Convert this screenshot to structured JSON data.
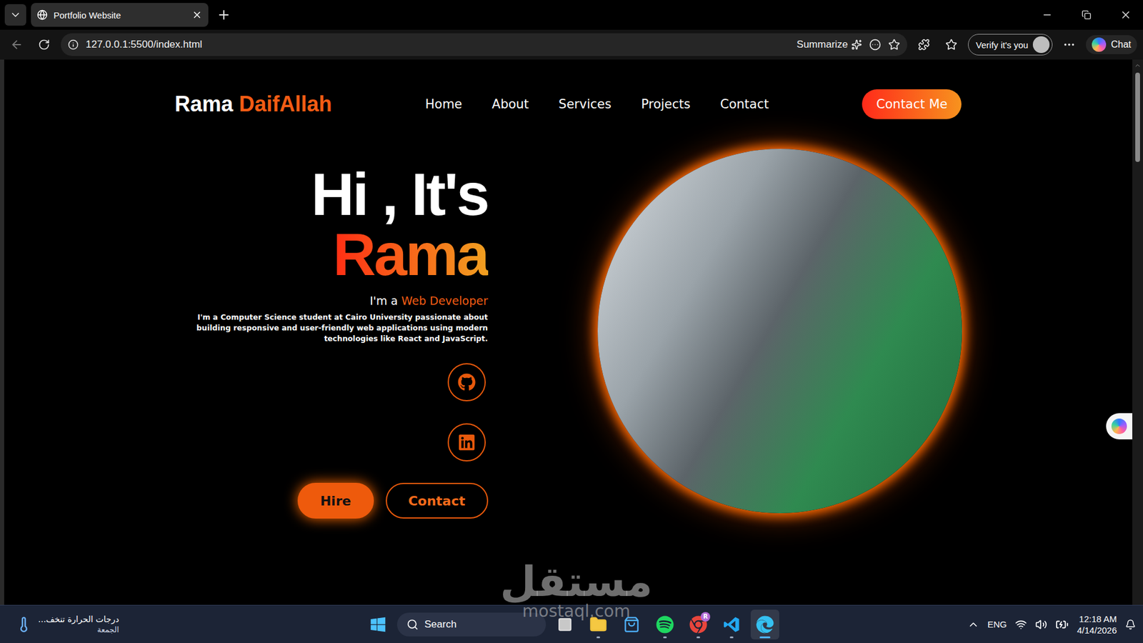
{
  "browser": {
    "tabs": [
      {
        "label": "Portfolio Website",
        "selected": true
      }
    ],
    "url": "127.0.0.1:5500/index.html",
    "summarize": "Summarize",
    "profile": "Verify it's you",
    "chat": "Chat"
  },
  "page": {
    "logo": {
      "first": "Rama",
      "last": "DaifAllah"
    },
    "nav": [
      {
        "label": "Home"
      },
      {
        "label": "About"
      },
      {
        "label": "Services"
      },
      {
        "label": "Projects"
      },
      {
        "label": "Contact"
      }
    ],
    "cta": "Contact Me",
    "hero": {
      "greeting": "Hi , It's",
      "name": "Rama",
      "role_prefix": "I'm a",
      "role": "Web Developer",
      "description": "I'm a Computer Science student at Cairo University passionate about building responsive and user-friendly web applications using modern technologies like React and JavaScript.",
      "buttons": [
        {
          "label": "Hire",
          "kind": "filled"
        },
        {
          "label": "Contact",
          "kind": "outline"
        }
      ]
    }
  },
  "taskbar": {
    "weather": {
      "text": "درجات الحرارة تنخف...",
      "day": "الجمعة"
    },
    "search": "Search",
    "apps": [
      {
        "kind": "widgets",
        "running": false,
        "selected": false
      },
      {
        "kind": "explorer",
        "running": true,
        "selected": false
      },
      {
        "kind": "store",
        "running": false,
        "selected": false
      },
      {
        "kind": "spotify",
        "running": true,
        "selected": false
      },
      {
        "kind": "chrome",
        "running": true,
        "selected": false,
        "badge": "R"
      },
      {
        "kind": "vscode",
        "running": true,
        "selected": false
      },
      {
        "kind": "edge",
        "running": true,
        "selected": true
      }
    ],
    "language": "ENG",
    "time": "12:18 AM",
    "date": "4/14/2026"
  },
  "watermark": {
    "arabic": "مستقل",
    "latin": "mostaql.com"
  }
}
